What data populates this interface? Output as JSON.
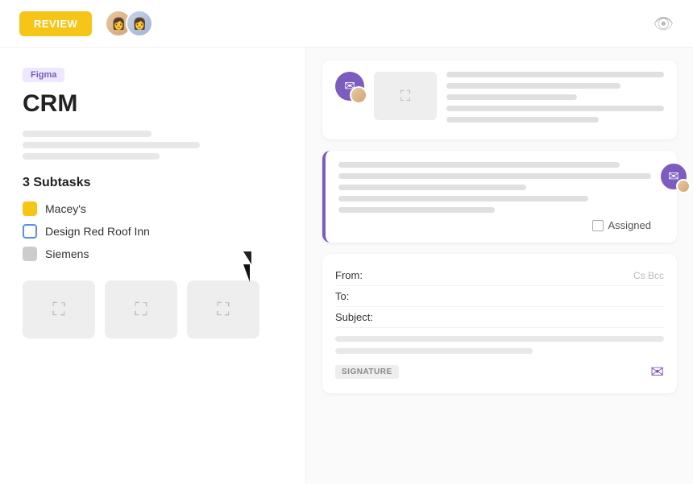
{
  "header": {
    "review_label": "REVIEW",
    "eye_icon": "eye"
  },
  "left": {
    "badge": "Figma",
    "title": "CRM",
    "subtasks_heading": "3 Subtasks",
    "subtasks": [
      {
        "label": "Macey's",
        "icon_type": "yellow"
      },
      {
        "label": "Design Red Roof Inn",
        "icon_type": "blue"
      },
      {
        "label": "Siemens",
        "icon_type": "gray"
      }
    ],
    "thumbnails": [
      "image",
      "image",
      "image"
    ]
  },
  "right": {
    "card1": {
      "lines": [
        "full",
        "80",
        "60"
      ]
    },
    "card2": {
      "lines": [
        "full",
        "90",
        "60"
      ],
      "assigned_label": "Assigned"
    },
    "email": {
      "from_label": "From:",
      "to_label": "To:",
      "subject_label": "Subject:",
      "cc_label": "Cs Bcc",
      "signature_label": "SIGNATURE"
    }
  }
}
